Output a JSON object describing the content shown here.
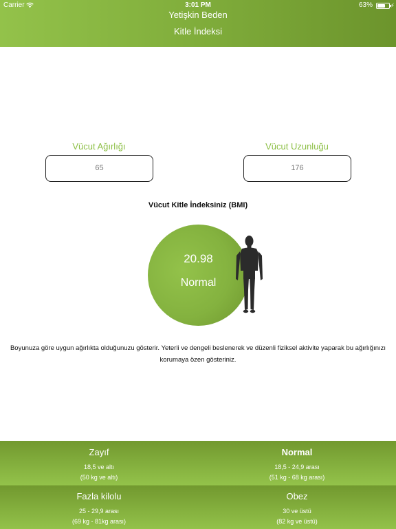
{
  "status_bar": {
    "carrier": "Carrier",
    "time": "3:01 PM",
    "battery_percent": "63%",
    "battery_level": 0.63
  },
  "header": {
    "title": "Yetişkin Beden",
    "subtitle": "Kitle İndeksi"
  },
  "inputs": {
    "weight": {
      "label": "Vücut Ağırlığı",
      "value": "65"
    },
    "height": {
      "label": "Vücut Uzunluğu",
      "value": "176"
    }
  },
  "result": {
    "heading": "Vücut Kitle İndeksiniz (BMI)",
    "value": "20.98",
    "category": "Normal",
    "description": "Boyunuza göre uygun ağırlıkta olduğunuzu gösterir. Yeterli ve dengeli beslenerek ve düzenli fiziksel aktivite yaparak bu ağırlığınızı korumaya özen gösteriniz."
  },
  "legend": [
    {
      "name": "Zayıf",
      "range": "18,5 ve altı",
      "weight": "(50 kg ve altı)",
      "active": false
    },
    {
      "name": "Normal",
      "range": "18,5 - 24,9 arası",
      "weight": "(51 kg - 68 kg arası)",
      "active": true
    },
    {
      "name": "Fazla kilolu",
      "range": "25 - 29,9 arası",
      "weight": "(69 kg - 81kg arası)",
      "active": false
    },
    {
      "name": "Obez",
      "range": "30 ve üstü",
      "weight": "(82 kg ve üstü)",
      "active": false
    }
  ],
  "colors": {
    "accent_green": "#8cbf45",
    "header_green_dark": "#6c942c",
    "figure": "#2b2b2b"
  }
}
